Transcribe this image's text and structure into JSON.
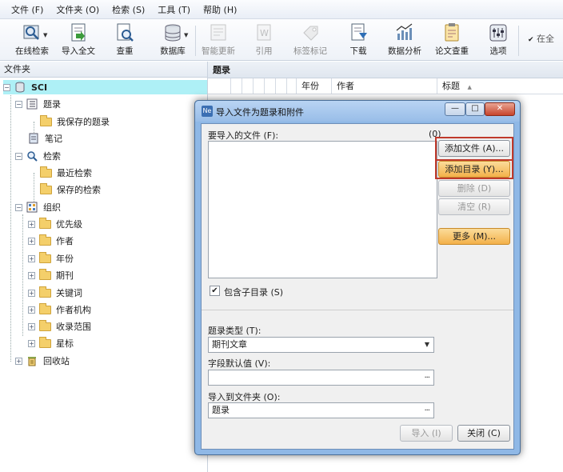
{
  "menu": [
    "文件 (F)",
    "文件夹 (O)",
    "检索 (S)",
    "工具 (T)",
    "帮助 (H)"
  ],
  "toolbar": {
    "items": [
      {
        "label": "在线检索",
        "icon": "online-search-icon",
        "disabled": false
      },
      {
        "label": "导入全文",
        "icon": "import-fulltext-icon",
        "disabled": false
      },
      {
        "label": "查重",
        "icon": "dedup-icon",
        "disabled": false
      },
      {
        "label": "数据库",
        "icon": "database-icon",
        "disabled": false
      },
      {
        "label": "智能更新",
        "icon": "smart-update-icon",
        "disabled": true
      },
      {
        "label": "引用",
        "icon": "cite-icon",
        "disabled": true
      },
      {
        "label": "标签标记",
        "icon": "tag-icon",
        "disabled": true
      },
      {
        "label": "下载",
        "icon": "download-icon",
        "disabled": false
      },
      {
        "label": "数据分析",
        "icon": "data-analysis-icon",
        "disabled": false
      },
      {
        "label": "论文查重",
        "icon": "paper-check-icon",
        "disabled": false
      },
      {
        "label": "选项",
        "icon": "options-icon",
        "disabled": false
      }
    ],
    "overflow_label": "在全"
  },
  "left_panel": {
    "header": "文件夹",
    "tree": {
      "root": "SCI",
      "records": "题录",
      "saved_records": "我保存的题录",
      "notes": "笔记",
      "search": "检索",
      "recent_search": "最近检索",
      "saved_search": "保存的检索",
      "organize": "组织",
      "org_items": [
        "优先级",
        "作者",
        "年份",
        "期刊",
        "关键词",
        "作者机构",
        "收录范围",
        "星标"
      ],
      "trash": "回收站"
    }
  },
  "right_panel": {
    "header": "题录",
    "columns": [
      "年份",
      "作者",
      "标题"
    ],
    "sort_indicator": "▲"
  },
  "dialog": {
    "title": "导入文件为题录和附件",
    "files_label": "要导入的文件 (F):",
    "files_label_key": "F",
    "file_count": "(0)",
    "buttons": {
      "add_file": "添加文件 (A)...",
      "add_dir": "添加目录 (Y)...",
      "delete": "删除 (D)",
      "clear": "清空 (R)",
      "more": "更多 (M)..."
    },
    "include_subdirs": "包含子目录 (S)",
    "include_subdirs_checked": true,
    "record_type_label": "题录类型 (T):",
    "record_type_value": "期刊文章",
    "field_default_label": "字段默认值 (V):",
    "field_default_value": "",
    "import_to_label": "导入到文件夹 (O):",
    "import_to_value": "题录",
    "import_button": "导入 (I)",
    "close_button": "关闭 (C)",
    "browse_glyph": "..."
  }
}
